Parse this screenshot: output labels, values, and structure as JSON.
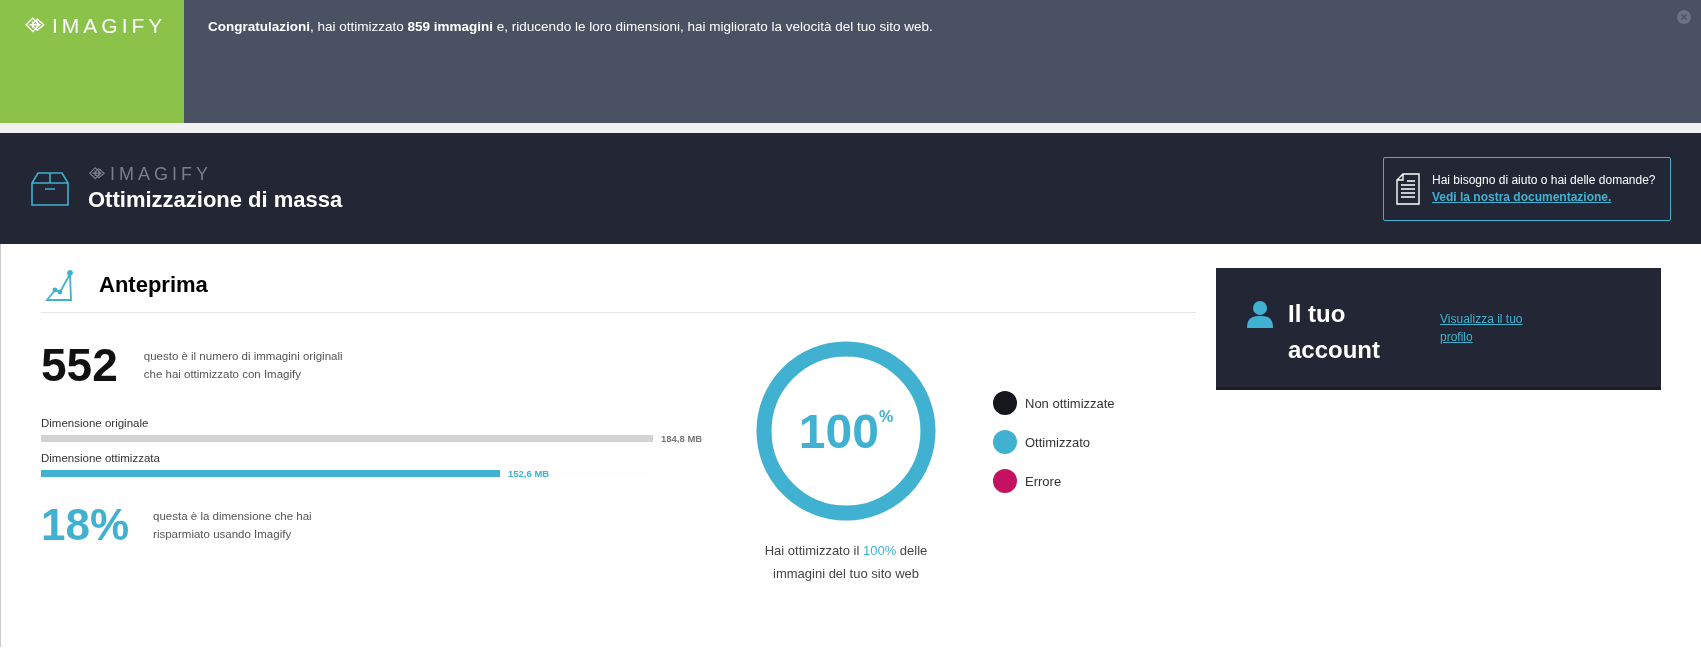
{
  "notice": {
    "logo": "IMAGIFY",
    "message": "**Congratulazioni**, hai ottimizzato **859 immagini** e, riducendo le loro dimensioni, hai migliorato la velocità del tuo sito web."
  },
  "header": {
    "logo": "IMAGIFY",
    "title": "Ottimizzazione di massa",
    "help": {
      "question": "Hai bisogno di aiuto o hai delle domande?",
      "link": "Vedi la nostra documentazione."
    }
  },
  "preview": {
    "title": "Anteprima",
    "images_count": "552",
    "images_text": "questo è il numero di immagini originali che hai ottimizzato con Imagify",
    "sizes": [
      {
        "kind": "original",
        "label": "Dimensione originale",
        "level": 1,
        "reading": "184,8 MB"
      },
      {
        "kind": "optimized",
        "label": "Dimensione ottimizzata",
        "level": 0.75,
        "reading": "152,6 MB"
      }
    ],
    "saved_percent": "18%",
    "saved_text": "questa è la dimensione che hai risparmiato usando Imagify",
    "donut": {
      "level": 1,
      "value": "100",
      "unit": "%"
    },
    "legend": [
      {
        "label": "Non ottimizzate",
        "color": "#16171c"
      },
      {
        "label": "Ottimizzato",
        "color": "#40b1d0"
      },
      {
        "label": "Errore",
        "color": "#c51162"
      }
    ],
    "caption": {
      "before": "Hai ottimizzato il",
      "highlight": "100%",
      "after": "delle immagini del tuo sito web"
    }
  },
  "account": {
    "title": "Il tuo account",
    "link": "Visualizza il tuo profilo"
  }
}
